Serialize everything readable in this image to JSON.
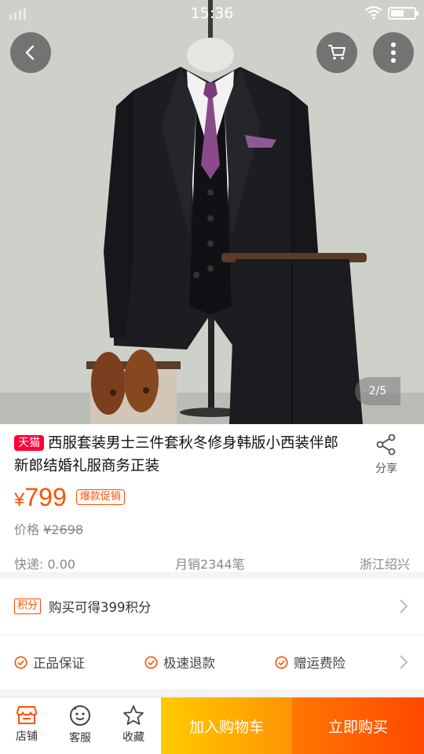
{
  "status_bar": {
    "time": "15:36"
  },
  "gallery": {
    "counter": "2/5",
    "image_alt": "Black three-piece suit on mannequin with brown loafers"
  },
  "product": {
    "platform_badge": "天猫",
    "title": "西服套装男士三件套秋冬修身韩版小西装伴郎新郎结婚礼服商务正装",
    "price_symbol": "¥",
    "price": "799",
    "promo_badge": "爆款促销",
    "original_price_label": "价格",
    "original_price": "¥2698",
    "shipping": "快递: 0.00",
    "monthly_sales": "月销2344笔",
    "location": "浙江绍兴"
  },
  "share": {
    "label": "分享"
  },
  "points": {
    "badge": "积分",
    "text": "购买可得399积分"
  },
  "guarantees": [
    "正品保证",
    "极速退款",
    "赠运费险"
  ],
  "bottom_bar": {
    "store_label": "店铺",
    "service_label": "客服",
    "favorite_label": "收藏",
    "add_to_cart": "加入购物车",
    "buy_now": "立即购买"
  },
  "colors": {
    "accent": "#ff5000",
    "tmall_red": "#ff0036",
    "cart_yellow": "#ffb300",
    "buy_orange": "#ff6000"
  }
}
